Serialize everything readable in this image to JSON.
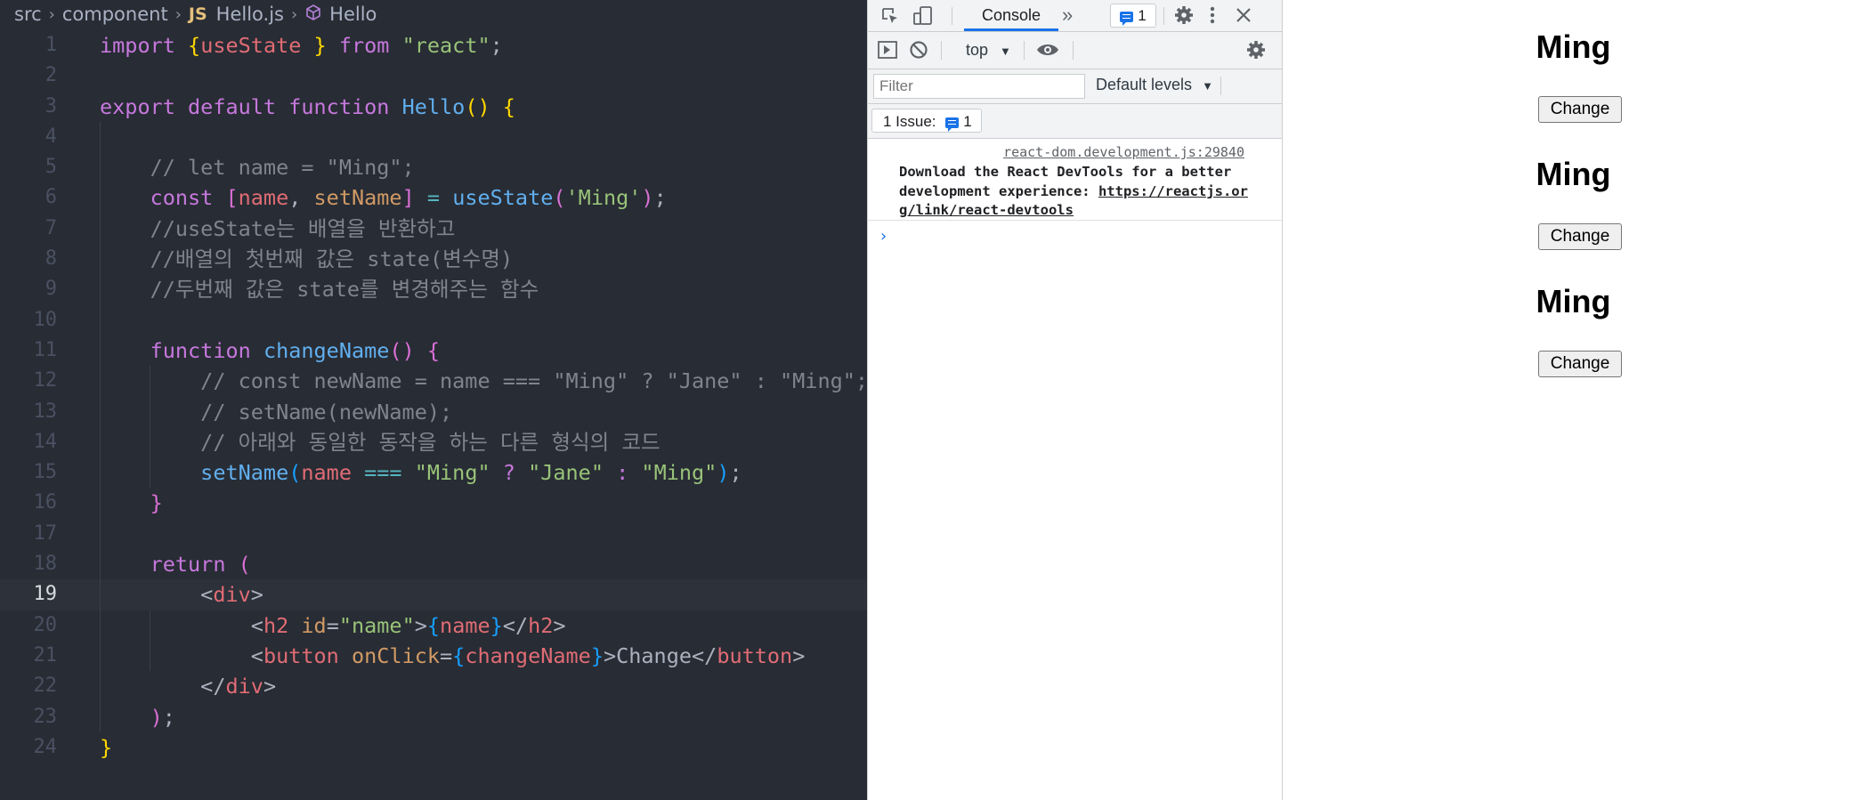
{
  "breadcrumb": {
    "folder": "src",
    "subfolder": "component",
    "file_badge": "JS",
    "file": "Hello.js",
    "symbol": "Hello"
  },
  "editor": {
    "active_line": 19,
    "lines": [
      {
        "n": "1",
        "indent": 0,
        "tokens": [
          [
            "kw",
            "import "
          ],
          [
            "br1",
            "{"
          ],
          [
            "var",
            "useState"
          ],
          [
            "br1",
            " }"
          ],
          [
            "kw",
            " from "
          ],
          [
            "str",
            "\"react\""
          ],
          [
            "pl",
            ";"
          ]
        ]
      },
      {
        "n": "2",
        "indent": 0,
        "tokens": []
      },
      {
        "n": "3",
        "indent": 0,
        "tokens": [
          [
            "kw",
            "export default function "
          ],
          [
            "fn",
            "Hello"
          ],
          [
            "br1",
            "() {"
          ]
        ]
      },
      {
        "n": "4",
        "indent": 1,
        "tokens": []
      },
      {
        "n": "5",
        "indent": 1,
        "tokens": [
          [
            "cmt",
            "    // let name = \"Ming\";"
          ]
        ]
      },
      {
        "n": "6",
        "indent": 1,
        "tokens": [
          [
            "kw",
            "    const "
          ],
          [
            "br2",
            "["
          ],
          [
            "var",
            "name"
          ],
          [
            "pl",
            ", "
          ],
          [
            "attr",
            "setName"
          ],
          [
            "br2",
            "]"
          ],
          [
            "op",
            " = "
          ],
          [
            "fn",
            "useState"
          ],
          [
            "br2",
            "("
          ],
          [
            "str",
            "'Ming'"
          ],
          [
            "br2",
            ")"
          ],
          [
            "pl",
            ";"
          ]
        ]
      },
      {
        "n": "7",
        "indent": 1,
        "tokens": [
          [
            "cmt",
            "    //useState는 배열을 반환하고"
          ]
        ]
      },
      {
        "n": "8",
        "indent": 1,
        "tokens": [
          [
            "cmt",
            "    //배열의 첫번째 값은 state(변수명)"
          ]
        ]
      },
      {
        "n": "9",
        "indent": 1,
        "tokens": [
          [
            "cmt",
            "    //두번째 값은 state를 변경해주는 함수"
          ]
        ]
      },
      {
        "n": "10",
        "indent": 1,
        "tokens": []
      },
      {
        "n": "11",
        "indent": 1,
        "tokens": [
          [
            "kw",
            "    function "
          ],
          [
            "fn",
            "changeName"
          ],
          [
            "br2",
            "() {"
          ]
        ]
      },
      {
        "n": "12",
        "indent": 2,
        "tokens": [
          [
            "cmt",
            "        // const newName = name === \"Ming\" ? \"Jane\" : \"Ming\";"
          ]
        ]
      },
      {
        "n": "13",
        "indent": 2,
        "tokens": [
          [
            "cmt",
            "        // setName(newName);"
          ]
        ]
      },
      {
        "n": "14",
        "indent": 2,
        "tokens": [
          [
            "cmt",
            "        // 아래와 동일한 동작을 하는 다른 형식의 코드"
          ]
        ]
      },
      {
        "n": "15",
        "indent": 2,
        "tokens": [
          [
            "fn",
            "        setName"
          ],
          [
            "br3",
            "("
          ],
          [
            "var",
            "name"
          ],
          [
            "op",
            " === "
          ],
          [
            "str",
            "\"Ming\""
          ],
          [
            "kw",
            " ? "
          ],
          [
            "str",
            "\"Jane\""
          ],
          [
            "kw",
            " : "
          ],
          [
            "str",
            "\"Ming\""
          ],
          [
            "br3",
            ")"
          ],
          [
            "pl",
            ";"
          ]
        ]
      },
      {
        "n": "16",
        "indent": 1,
        "tokens": [
          [
            "br2",
            "    }"
          ]
        ]
      },
      {
        "n": "17",
        "indent": 1,
        "tokens": []
      },
      {
        "n": "18",
        "indent": 1,
        "tokens": [
          [
            "kw",
            "    return "
          ],
          [
            "br2",
            "("
          ]
        ]
      },
      {
        "n": "19",
        "indent": 1,
        "tokens": [
          [
            "pl",
            "        <"
          ],
          [
            "tag",
            "div"
          ],
          [
            "pl",
            ">"
          ]
        ]
      },
      {
        "n": "20",
        "indent": 2,
        "tokens": [
          [
            "pl",
            "            <"
          ],
          [
            "tag",
            "h2"
          ],
          [
            "attr",
            " id"
          ],
          [
            "pl",
            "="
          ],
          [
            "str",
            "\"name\""
          ],
          [
            "pl",
            ">"
          ],
          [
            "br3",
            "{"
          ],
          [
            "var",
            "name"
          ],
          [
            "br3",
            "}"
          ],
          [
            "pl",
            "</"
          ],
          [
            "tag",
            "h2"
          ],
          [
            "pl",
            ">"
          ]
        ]
      },
      {
        "n": "21",
        "indent": 2,
        "tokens": [
          [
            "pl",
            "            <"
          ],
          [
            "tag",
            "button"
          ],
          [
            "attr",
            " onClick"
          ],
          [
            "pl",
            "="
          ],
          [
            "br3",
            "{"
          ],
          [
            "var",
            "changeName"
          ],
          [
            "br3",
            "}"
          ],
          [
            "pl",
            ">Change</"
          ],
          [
            "tag",
            "button"
          ],
          [
            "pl",
            ">"
          ]
        ]
      },
      {
        "n": "22",
        "indent": 1,
        "tokens": [
          [
            "pl",
            "        </"
          ],
          [
            "tag",
            "div"
          ],
          [
            "pl",
            ">"
          ]
        ]
      },
      {
        "n": "23",
        "indent": 1,
        "tokens": [
          [
            "br2",
            "    )"
          ],
          [
            "pl",
            ";"
          ]
        ]
      },
      {
        "n": "24",
        "indent": 0,
        "tokens": [
          [
            "br1",
            "}"
          ]
        ]
      }
    ]
  },
  "devtools": {
    "tab_console": "Console",
    "issues_count_top": "1",
    "context": "top",
    "filter_placeholder": "Filter",
    "levels": "Default levels",
    "issues_label": "1 Issue:",
    "issues_count": "1",
    "log_source": "react-dom.development.js:29840",
    "log_text": "Download the React DevTools for a better development experience: ",
    "log_link": "https://reactjs.org/link/react-devtools",
    "prompt": "›"
  },
  "page": {
    "items": [
      {
        "heading": "Ming",
        "button": "Change"
      },
      {
        "heading": "Ming",
        "button": "Change"
      },
      {
        "heading": "Ming",
        "button": "Change"
      }
    ]
  },
  "colors": {
    "editor_bg": "#282c34",
    "accent": "#1a73e8"
  }
}
